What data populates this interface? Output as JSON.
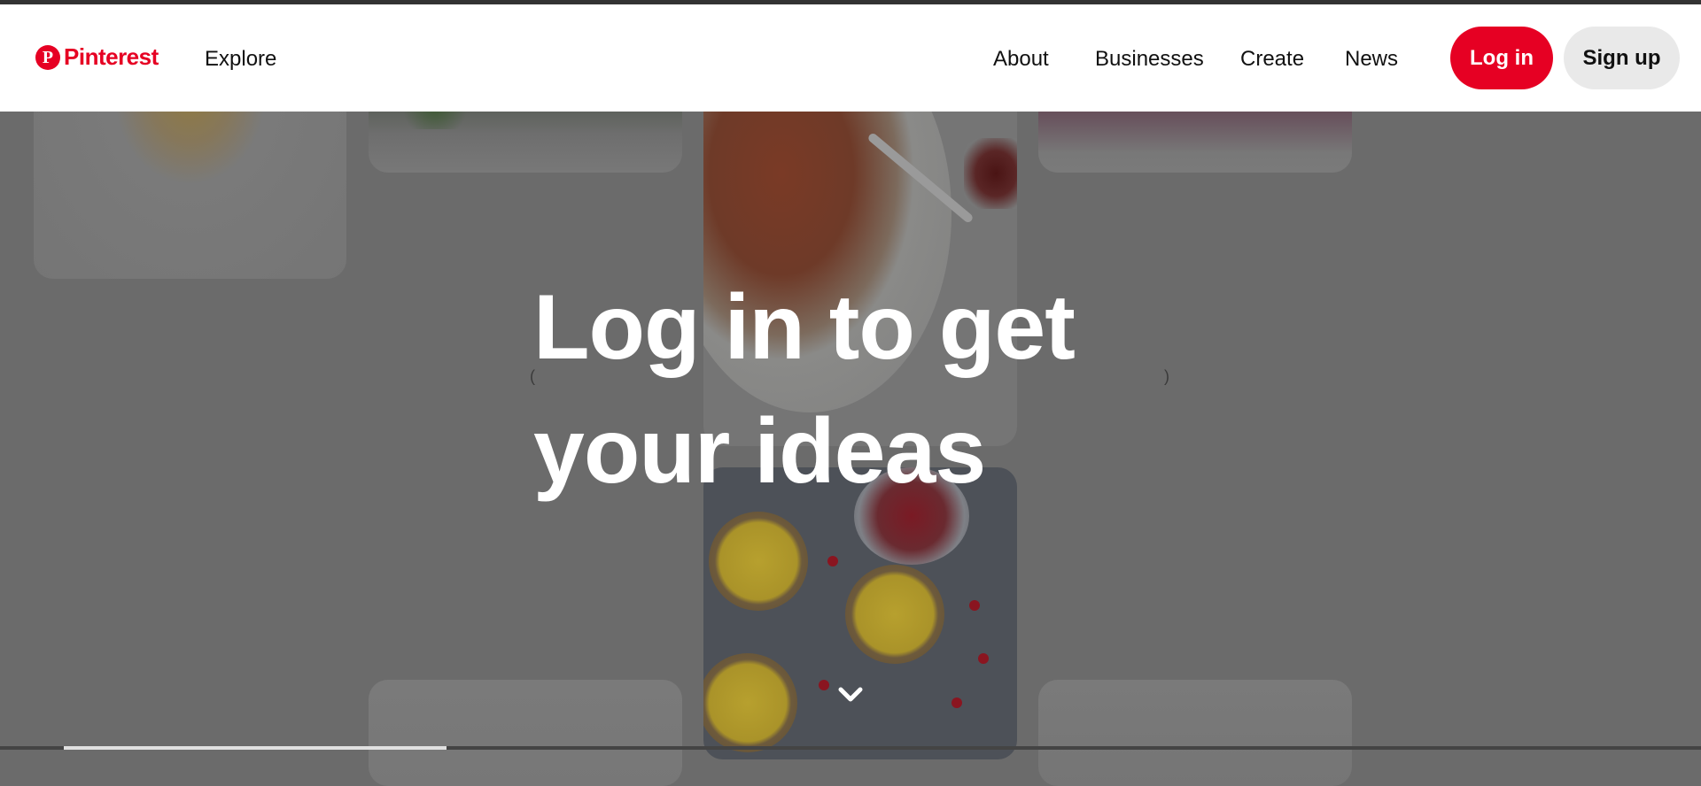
{
  "brand": {
    "name": "Pinterest",
    "color": "#e60023"
  },
  "nav": {
    "explore": "Explore",
    "links": [
      "About",
      "Businesses",
      "Create",
      "News"
    ]
  },
  "actions": {
    "login": "Log in",
    "signup": "Sign up"
  },
  "hero": {
    "line1": "Log in to get",
    "line2": "your ideas",
    "paren_left": "(",
    "paren_right": ")"
  },
  "icons": {
    "scroll": "chevron-down-icon",
    "logo": "pinterest-logo-icon"
  }
}
